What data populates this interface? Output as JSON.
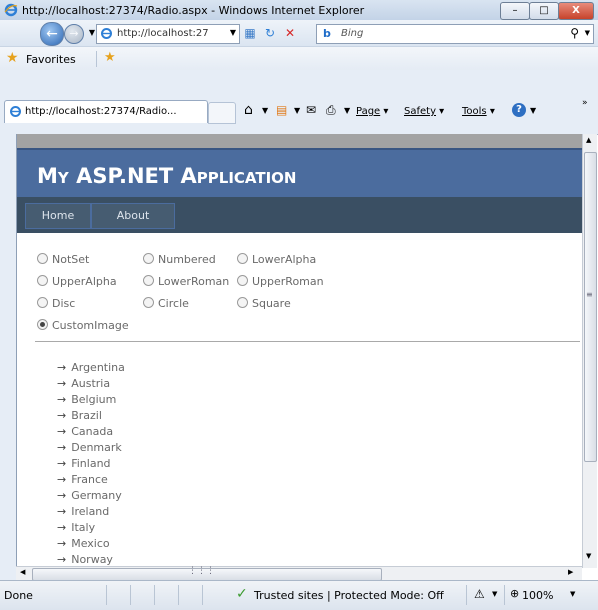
{
  "window": {
    "title": "http://localhost:27374/Radio.aspx - Windows Internet Explorer",
    "minimize_label": "–",
    "maximize_label": "□",
    "close_label": "X"
  },
  "address": {
    "url": "http://localhost:27",
    "search_placeholder": "Bing",
    "search_engine": "b"
  },
  "favorites": {
    "label": "Favorites"
  },
  "tab": {
    "label": "http://localhost:27374/Radio..."
  },
  "commandbar": {
    "page_label": "Page",
    "safety_label": "Safety",
    "tools_label": "Tools"
  },
  "site": {
    "title": "My ASP.NET Application",
    "menu": [
      "Home",
      "About"
    ]
  },
  "radio_options": [
    {
      "label": "NotSet",
      "checked": false
    },
    {
      "label": "Numbered",
      "checked": false
    },
    {
      "label": "LowerAlpha",
      "checked": false
    },
    {
      "label": "UpperAlpha",
      "checked": false
    },
    {
      "label": "LowerRoman",
      "checked": false
    },
    {
      "label": "UpperRoman",
      "checked": false
    },
    {
      "label": "Disc",
      "checked": false
    },
    {
      "label": "Circle",
      "checked": false
    },
    {
      "label": "Square",
      "checked": false
    },
    {
      "label": "CustomImage",
      "checked": true
    }
  ],
  "bullet_symbol": "→",
  "countries": [
    "Argentina",
    "Austria",
    "Belgium",
    "Brazil",
    "Canada",
    "Denmark",
    "Finland",
    "France",
    "Germany",
    "Ireland",
    "Italy",
    "Mexico",
    "Norway"
  ],
  "status": {
    "left": "Done",
    "zone": "Trusted sites | Protected Mode: Off",
    "zoom": "100%"
  },
  "colors": {
    "header_bg": "#4b6c9e",
    "menu_bg": "#3a4f63",
    "menu_item_bg": "#465c71"
  }
}
